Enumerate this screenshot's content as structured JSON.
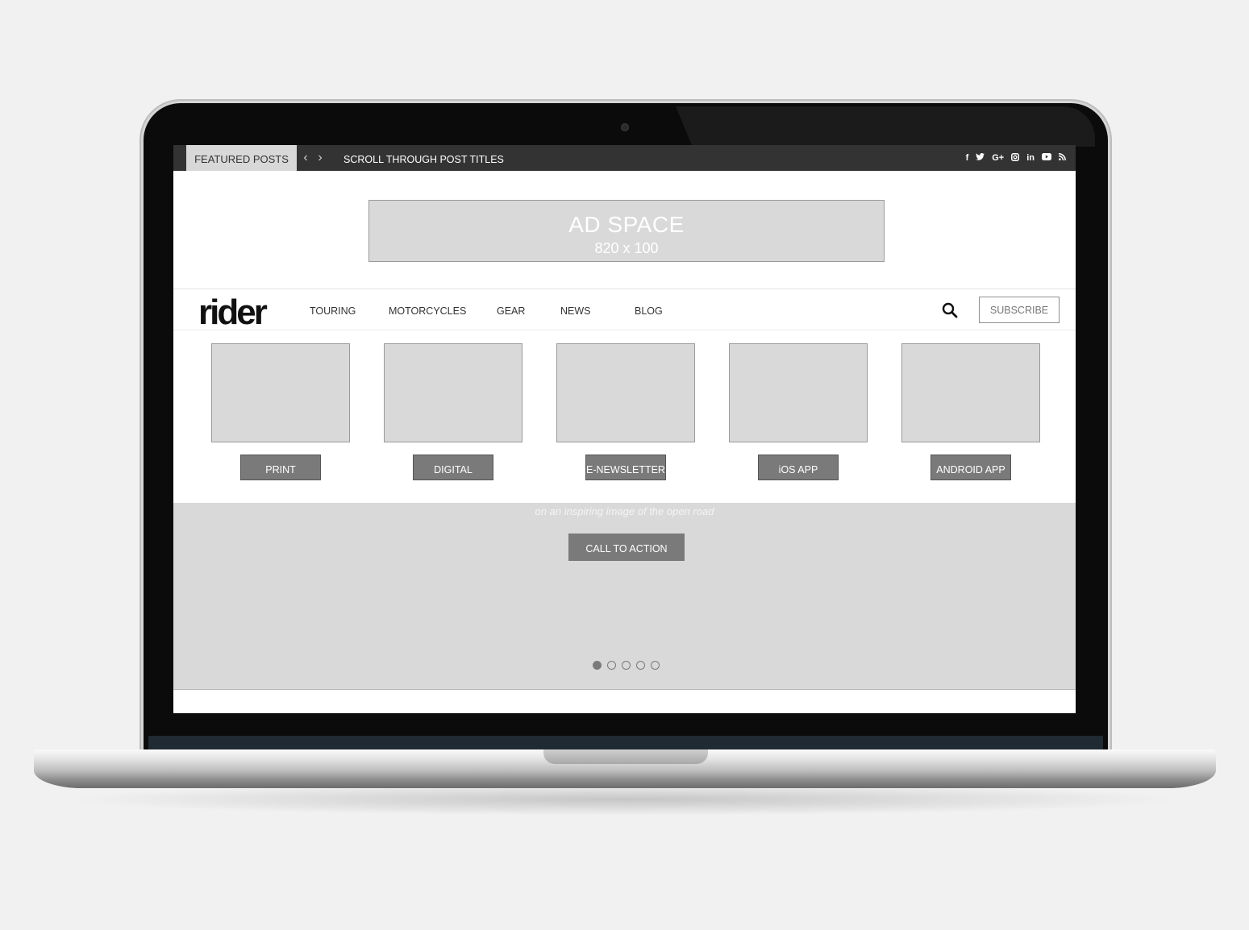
{
  "topbar": {
    "featured_label": "FEATURED POSTS",
    "prev_arrow": "‹",
    "next_arrow": "›",
    "scroll_text": "SCROLL THROUGH POST TITLES",
    "social": [
      {
        "icon": "facebook-icon",
        "glyph": "f"
      },
      {
        "icon": "twitter-icon",
        "glyph": "🐦"
      },
      {
        "icon": "google-plus-icon",
        "glyph": "G+"
      },
      {
        "icon": "instagram-icon",
        "glyph": "◙"
      },
      {
        "icon": "linkedin-icon",
        "glyph": "in"
      },
      {
        "icon": "youtube-icon",
        "glyph": "▶"
      },
      {
        "icon": "rss-icon",
        "glyph": "◥"
      }
    ]
  },
  "ad": {
    "title": "AD SPACE",
    "size": "820 x 100"
  },
  "nav": {
    "logo": "rider",
    "items": [
      "TOURING",
      "MOTORCYCLES",
      "GEAR",
      "NEWS",
      "BLOG"
    ],
    "subscribe_label": "SUBSCRIBE"
  },
  "products": [
    {
      "label": "PRINT"
    },
    {
      "label": "DIGITAL"
    },
    {
      "label": "E-NEWSLETTER"
    },
    {
      "label": "iOS APP"
    },
    {
      "label": "ANDROID APP"
    }
  ],
  "hero": {
    "caption": "on an inspiring image of the open road",
    "cta_label": "CALL TO ACTION",
    "slides": 5,
    "active_slide": 1
  },
  "colors": {
    "topbar_bg": "#333333",
    "placeholder_gray": "#d9d9d9",
    "button_gray": "#7a7a7a"
  }
}
